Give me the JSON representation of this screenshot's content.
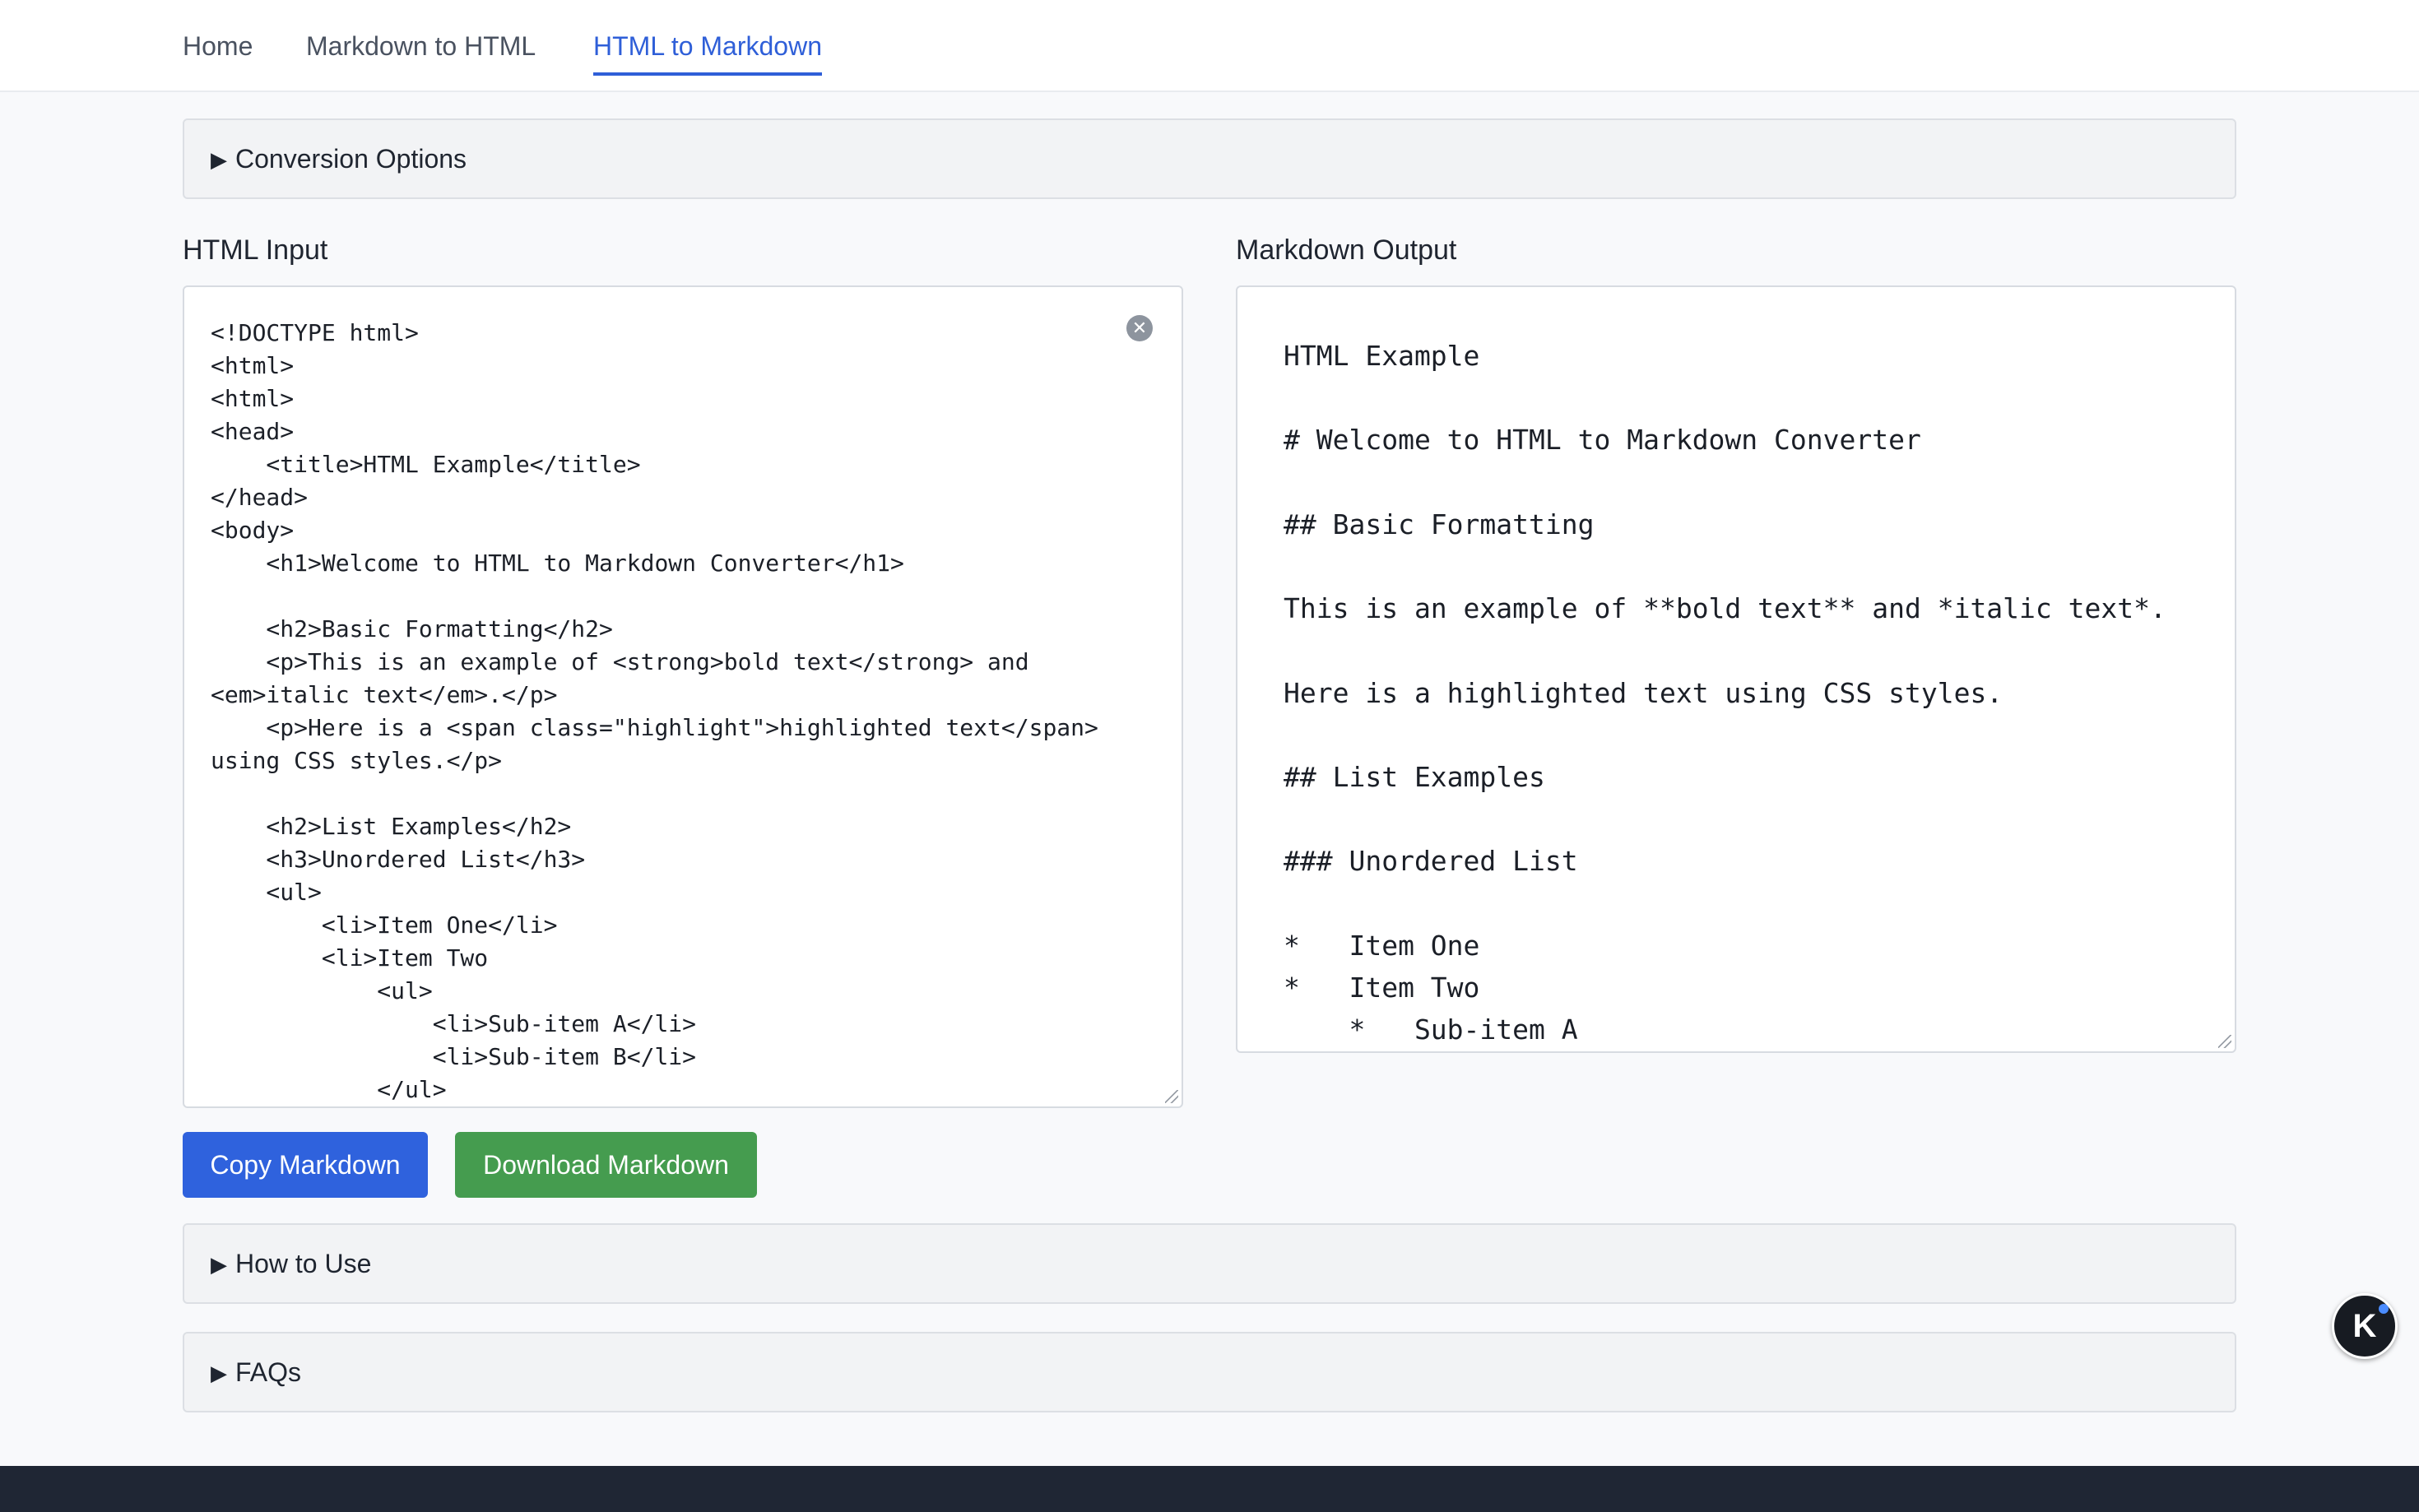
{
  "nav": {
    "items": [
      {
        "label": "Home"
      },
      {
        "label": "Markdown to HTML"
      },
      {
        "label": "HTML to Markdown"
      }
    ],
    "active": "HTML to Markdown"
  },
  "conversion_options": {
    "label": "Conversion Options"
  },
  "html_input": {
    "title": "HTML Input",
    "code": "<!DOCTYPE html>\n<html>\n<html>\n<head>\n    <title>HTML Example</title>\n</head>\n<body>\n    <h1>Welcome to HTML to Markdown Converter</h1>\n\n    <h2>Basic Formatting</h2>\n    <p>This is an example of <strong>bold text</strong> and\n<em>italic text</em>.</p>\n    <p>Here is a <span class=\"highlight\">highlighted text</span>\nusing CSS styles.</p>\n\n    <h2>List Examples</h2>\n    <h3>Unordered List</h3>\n    <ul>\n        <li>Item One</li>\n        <li>Item Two\n            <ul>\n                <li>Sub-item A</li>\n                <li>Sub-item B</li>\n            </ul>"
  },
  "markdown_output": {
    "title": "Markdown Output",
    "code": "HTML Example\n\n# Welcome to HTML to Markdown Converter\n\n## Basic Formatting\n\nThis is an example of **bold text** and *italic text*.\n\nHere is a highlighted text using CSS styles.\n\n## List Examples\n\n### Unordered List\n\n*   Item One\n*   Item Two\n    *   Sub-item A"
  },
  "buttons": {
    "copy": "Copy Markdown",
    "download": "Download Markdown"
  },
  "accordions": {
    "how_to_use": "How to Use",
    "faqs": "FAQs"
  },
  "icons": {
    "caret": "triangle-right-icon",
    "clear": "close-circle-icon",
    "badge_letter": "K"
  },
  "colors": {
    "accent": "#2f62dd",
    "success": "#459c4f",
    "footer": "#1f2634"
  }
}
